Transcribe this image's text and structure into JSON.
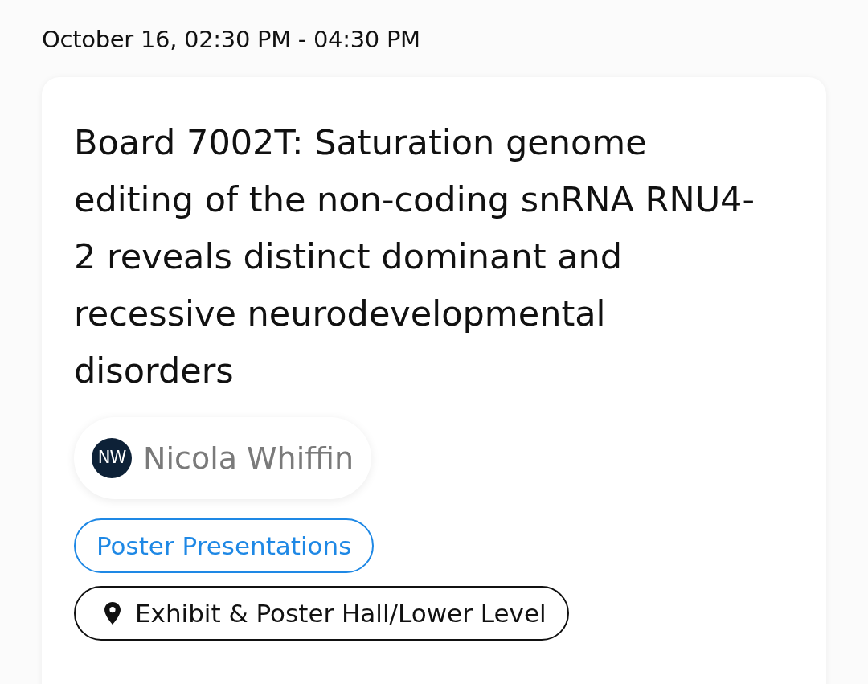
{
  "session_time": "October 16, 02:30 PM - 04:30 PM",
  "session": {
    "title": "Board 7002T: Saturation genome editing of the non-coding snRNA RNU4-2 reveals distinct dominant and recessive neurodevelopmental disorders",
    "speakers": [
      {
        "initials": "NW",
        "name": "Nicola Whiffin"
      }
    ],
    "tags": [
      {
        "kind": "track",
        "label": "Poster Presentations"
      },
      {
        "kind": "location",
        "label": "Exhibit & Poster Hall/Lower Level"
      }
    ]
  }
}
